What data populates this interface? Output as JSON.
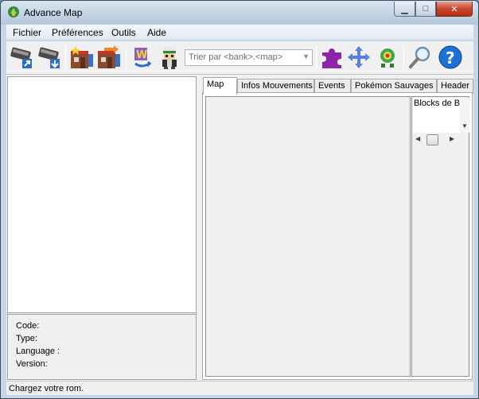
{
  "window": {
    "title": "Advance Map",
    "min_label": "▁",
    "max_label": "□",
    "close_label": "✕"
  },
  "menu": {
    "items": [
      "Fichier",
      "Préférences",
      "Outils",
      "Aide"
    ]
  },
  "toolbar": {
    "buttons": [
      "open-rom",
      "save-rom",
      "new-map",
      "import-map",
      "world-map",
      "player-sprite",
      "script-puzzle",
      "move-permissions",
      "wild-pokemon",
      "search",
      "help"
    ],
    "sort_combo_text": "Trier par <bank>.<map>"
  },
  "info": {
    "code_label": "Code:",
    "type_label": "Type:",
    "language_label": "Language :",
    "version_label": "Version:"
  },
  "tabs": [
    "Map",
    "Infos Mouvements",
    "Events",
    "Pokémon Sauvages",
    "Header"
  ],
  "blocks": {
    "title": "Blocks de B"
  },
  "status": {
    "text": "Chargez votre rom."
  }
}
